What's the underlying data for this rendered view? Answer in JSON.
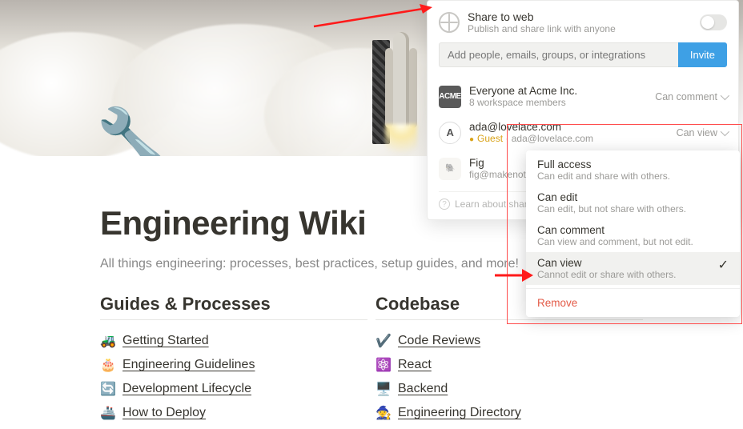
{
  "page": {
    "title": "Engineering Wiki",
    "subtitle": "All things engineering: processes, best practices, setup guides, and more!",
    "icon_name": "wrench-icon"
  },
  "columns": [
    {
      "heading": "Guides & Processes",
      "items": [
        {
          "emoji": "🚜",
          "label": "Getting Started"
        },
        {
          "emoji": "🎂",
          "label": "Engineering Guidelines"
        },
        {
          "emoji": "🔄",
          "label": "Development Lifecycle"
        },
        {
          "emoji": "🚢",
          "label": "How to Deploy"
        }
      ]
    },
    {
      "heading": "Codebase",
      "items": [
        {
          "emoji": "✔️",
          "label": "Code Reviews"
        },
        {
          "emoji": "⚛️",
          "label": "React"
        },
        {
          "emoji": "🖥️",
          "label": "Backend"
        },
        {
          "emoji": "🧙",
          "label": "Engineering Directory"
        }
      ]
    }
  ],
  "share": {
    "web_title": "Share to web",
    "web_desc": "Publish and share link with anyone",
    "invite_placeholder": "Add people, emails, groups, or integrations",
    "invite_btn": "Invite",
    "learn": "Learn about sharing",
    "members": [
      {
        "avatar": "ACME",
        "avatar_kind": "square",
        "name": "Everyone at Acme Inc.",
        "sub": "8 workspace members",
        "guest": false,
        "perm": "Can comment"
      },
      {
        "avatar": "A",
        "avatar_kind": "round",
        "name": "ada@lovelace.com",
        "sub": "ada@lovelace.com",
        "guest": true,
        "guest_label": "Guest",
        "perm": "Can view"
      },
      {
        "avatar": "🐘",
        "avatar_kind": "fig",
        "name": "Fig",
        "sub": "fig@makenotion.com",
        "guest": false,
        "perm": ""
      }
    ]
  },
  "permissions": [
    {
      "title": "Full access",
      "desc": "Can edit and share with others.",
      "selected": false
    },
    {
      "title": "Can edit",
      "desc": "Can edit, but not share with others.",
      "selected": false
    },
    {
      "title": "Can comment",
      "desc": "Can view and comment, but not edit.",
      "selected": false
    },
    {
      "title": "Can view",
      "desc": "Cannot edit or share with others.",
      "selected": true
    }
  ],
  "remove_label": "Remove"
}
